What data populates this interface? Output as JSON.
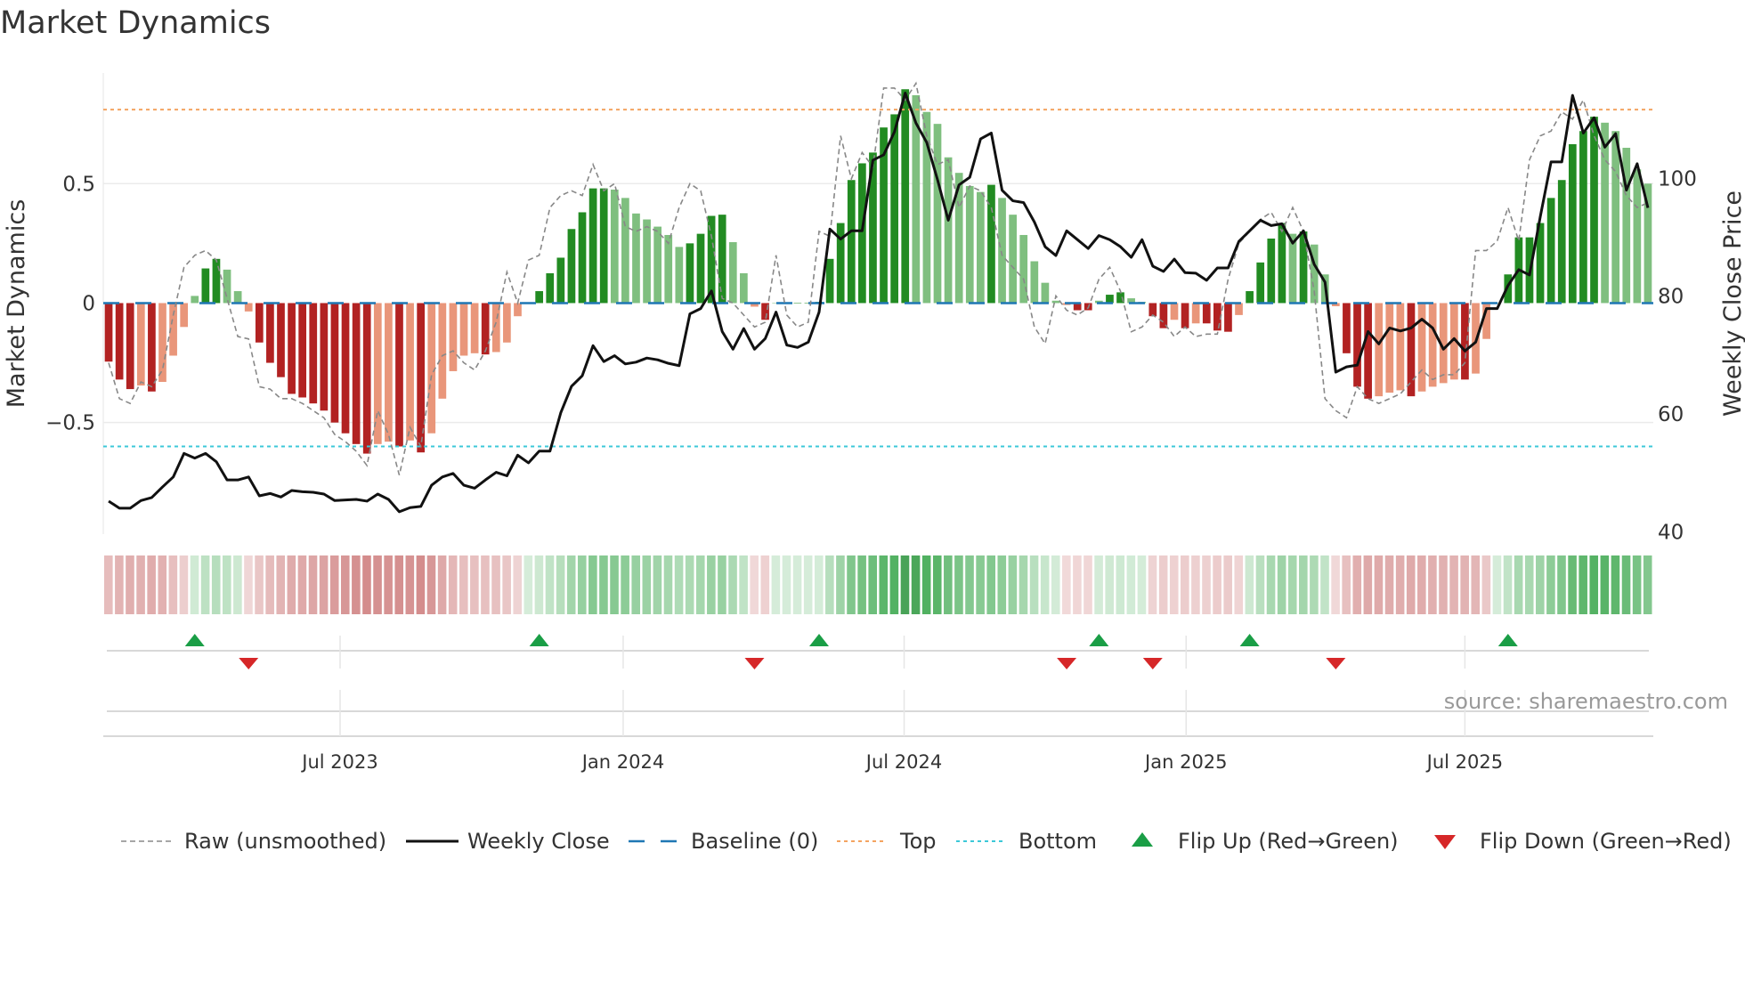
{
  "title": "Market Dynamics",
  "source": "source: sharemaestro.com",
  "colors": {
    "strong_up": "#228b22",
    "weak_up": "#7fbf7f",
    "strong_down": "#b22222",
    "weak_down": "#e9967a",
    "close": "#111111",
    "raw": "#888888",
    "baseline": "#1f77b4",
    "top": "#f4a460",
    "bottom": "#3cc8d8",
    "flip_up": "#1a9e46",
    "flip_down": "#d62728"
  },
  "chart_data": {
    "type": "bar+line",
    "title": "Market Dynamics",
    "ylabel": "Market Dynamics",
    "y2label": "Weekly Close Price",
    "ylim": [
      -0.967,
      0.963
    ],
    "y2lim": [
      39.6,
      117.9
    ],
    "yticks": [
      {
        "v": 0.5,
        "label": "0.5"
      },
      {
        "v": 0,
        "label": "0"
      },
      {
        "v": -0.5,
        "label": "−0.5"
      }
    ],
    "y2ticks": [
      {
        "v": 100,
        "label": "100"
      },
      {
        "v": 80,
        "label": "80"
      },
      {
        "v": 60,
        "label": "60"
      },
      {
        "v": 40,
        "label": "40"
      }
    ],
    "xticks": [
      {
        "week": 21.5,
        "label": "Jul 2023"
      },
      {
        "week": 47.8,
        "label": "Jan 2024"
      },
      {
        "week": 73.9,
        "label": "Jul 2024"
      },
      {
        "week": 100.1,
        "label": "Jan 2025"
      },
      {
        "week": 126.0,
        "label": "Jul 2025"
      }
    ],
    "top_level": 0.81,
    "bottom_level": -0.6,
    "baseline": 0,
    "dynamics": [
      -0.245,
      -0.32,
      -0.36,
      -0.345,
      -0.37,
      -0.33,
      -0.22,
      -0.1,
      0.03,
      0.145,
      0.185,
      0.14,
      0.05,
      -0.035,
      -0.165,
      -0.25,
      -0.31,
      -0.38,
      -0.395,
      -0.42,
      -0.45,
      -0.5,
      -0.545,
      -0.59,
      -0.63,
      -0.59,
      -0.58,
      -0.6,
      -0.575,
      -0.625,
      -0.545,
      -0.4,
      -0.285,
      -0.22,
      -0.21,
      -0.215,
      -0.205,
      -0.165,
      -0.055,
      0.0,
      0.05,
      0.125,
      0.19,
      0.31,
      0.38,
      0.48,
      0.48,
      0.475,
      0.44,
      0.375,
      0.35,
      0.32,
      0.285,
      0.235,
      0.25,
      0.29,
      0.365,
      0.37,
      0.255,
      0.125,
      -0.015,
      -0.07,
      0,
      0,
      0,
      0,
      0.005,
      0.185,
      0.335,
      0.515,
      0.585,
      0.63,
      0.735,
      0.79,
      0.895,
      0.87,
      0.8,
      0.75,
      0.61,
      0.545,
      0.49,
      0.465,
      0.495,
      0.44,
      0.37,
      0.285,
      0.175,
      0.085,
      0.01,
      -0.008,
      -0.03,
      -0.03,
      0.01,
      0.035,
      0.045,
      0.02,
      0.005,
      -0.055,
      -0.105,
      -0.07,
      -0.105,
      -0.085,
      -0.085,
      -0.115,
      -0.12,
      -0.05,
      0.05,
      0.17,
      0.27,
      0.335,
      0.29,
      0.3,
      0.245,
      0.12,
      -0.013,
      -0.21,
      -0.35,
      -0.4,
      -0.39,
      -0.375,
      -0.365,
      -0.39,
      -0.37,
      -0.35,
      -0.335,
      -0.32,
      -0.32,
      -0.295,
      -0.15,
      0.0,
      0.12,
      0.275,
      0.275,
      0.335,
      0.44,
      0.515,
      0.665,
      0.72,
      0.78,
      0.755,
      0.72,
      0.65,
      0.56,
      0.5
    ],
    "raw": [
      -0.25,
      -0.4,
      -0.42,
      -0.33,
      -0.35,
      -0.28,
      -0.05,
      0.15,
      0.2,
      0.22,
      0.18,
      0.02,
      -0.14,
      -0.15,
      -0.35,
      -0.36,
      -0.4,
      -0.4,
      -0.42,
      -0.45,
      -0.48,
      -0.55,
      -0.58,
      -0.62,
      -0.68,
      -0.45,
      -0.55,
      -0.72,
      -0.52,
      -0.6,
      -0.3,
      -0.22,
      -0.2,
      -0.25,
      -0.28,
      -0.2,
      -0.08,
      0.13,
      0.0,
      0.18,
      0.2,
      0.4,
      0.45,
      0.47,
      0.45,
      0.58,
      0.47,
      0.5,
      0.32,
      0.3,
      0.32,
      0.3,
      0.25,
      0.4,
      0.5,
      0.47,
      0.28,
      0.02,
      0.0,
      -0.05,
      -0.1,
      -0.08,
      0.2,
      -0.05,
      -0.1,
      -0.08,
      0.3,
      0.28,
      0.7,
      0.52,
      0.63,
      0.57,
      0.9,
      0.9,
      0.85,
      0.92,
      0.7,
      0.58,
      0.6,
      0.4,
      0.49,
      0.47,
      0.4,
      0.2,
      0.15,
      0.1,
      -0.1,
      -0.17,
      0.03,
      -0.03,
      -0.05,
      -0.02,
      0.1,
      0.15,
      0.05,
      -0.12,
      -0.1,
      -0.05,
      -0.08,
      -0.14,
      -0.1,
      -0.14,
      -0.13,
      -0.13,
      0.1,
      0.25,
      0.3,
      0.35,
      0.38,
      0.3,
      0.4,
      0.3,
      0.05,
      -0.4,
      -0.45,
      -0.48,
      -0.35,
      -0.4,
      -0.42,
      -0.4,
      -0.38,
      -0.33,
      -0.28,
      -0.32,
      -0.3,
      -0.3,
      -0.25,
      0.22,
      0.22,
      0.26,
      0.4,
      0.26,
      0.6,
      0.7,
      0.72,
      0.8,
      0.77,
      0.85,
      0.7,
      0.6,
      0.55,
      0.45,
      0.4,
      0.42
    ],
    "close": [
      45.2,
      44.0,
      44.0,
      45.3,
      45.8,
      47.6,
      49.3,
      53.3,
      52.5,
      53.3,
      51.9,
      48.8,
      48.8,
      49.3,
      46.1,
      46.5,
      45.9,
      47.0,
      46.8,
      46.7,
      46.4,
      45.3,
      45.4,
      45.5,
      45.2,
      46.4,
      45.5,
      43.4,
      44.1,
      44.3,
      47.9,
      49.3,
      49.9,
      47.9,
      47.4,
      48.8,
      50.1,
      49.5,
      53.0,
      51.7,
      53.7,
      53.7,
      60.2,
      64.7,
      66.5,
      71.6,
      68.9,
      69.9,
      68.5,
      68.8,
      69.5,
      69.2,
      68.6,
      68.2,
      77.0,
      77.9,
      80.9,
      74.0,
      71.0,
      74.5,
      71.0,
      72.8,
      77.3,
      71.7,
      71.3,
      72.2,
      77.3,
      91.4,
      89.7,
      91.1,
      91.1,
      103.1,
      104.0,
      107.9,
      114.5,
      109.4,
      106.1,
      99.8,
      92.9,
      98.9,
      100.2,
      106.7,
      107.7,
      98.0,
      96.2,
      95.9,
      92.6,
      88.4,
      86.9,
      91.1,
      89.6,
      88.1,
      90.3,
      89.6,
      88.4,
      86.6,
      89.6,
      85.1,
      84.2,
      86.3,
      84.0,
      83.9,
      82.7,
      84.8,
      84.8,
      89.3,
      91.1,
      92.9,
      92.0,
      92.3,
      89.0,
      91.1,
      85.4,
      82.4,
      67.1,
      68.0,
      68.3,
      74.0,
      71.9,
      74.6,
      74.1,
      74.6,
      76.1,
      74.6,
      71.0,
      72.8,
      70.7,
      72.2,
      77.9,
      77.9,
      81.8,
      84.5,
      83.6,
      93.5,
      102.8,
      102.8,
      114.1,
      107.7,
      110.3,
      105.3,
      107.6,
      98.0,
      102.5,
      95.0
    ],
    "flips_up": [
      8,
      40,
      66,
      92,
      106,
      130
    ],
    "flips_down": [
      13,
      60,
      89,
      97,
      114
    ],
    "legend": [
      "Raw (unsmoothed)",
      "Weekly Close",
      "Baseline (0)",
      "Top",
      "Bottom",
      "Flip Up (Red→Green)",
      "Flip Down (Green→Red)"
    ],
    "legend_position": "bottom"
  }
}
